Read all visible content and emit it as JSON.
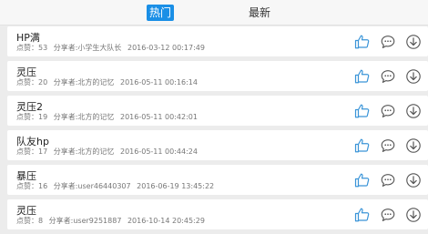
{
  "tabs": {
    "hot": "热门",
    "latest": "最新"
  },
  "colors": {
    "accent": "#1a8fe6",
    "like_icon": "#3b95d8",
    "icon_dark": "#555555"
  },
  "items": [
    {
      "title": "HP满",
      "likes_label": "点赞：53",
      "sharer_label": "分享者:小学生大队长",
      "timestamp": "2016-03-12 00:17:49"
    },
    {
      "title": "灵压",
      "likes_label": "点赞：20",
      "sharer_label": "分享者:北方的记忆",
      "timestamp": "2016-05-11 00:16:14"
    },
    {
      "title": "灵压2",
      "likes_label": "点赞：19",
      "sharer_label": "分享者:北方的记忆",
      "timestamp": "2016-05-11 00:42:01"
    },
    {
      "title": "队友hp",
      "likes_label": "点赞：17",
      "sharer_label": "分享者:北方的记忆",
      "timestamp": "2016-05-11 00:44:24"
    },
    {
      "title": "暴压",
      "likes_label": "点赞：16",
      "sharer_label": "分享者:user46440307",
      "timestamp": "2016-06-19 13:45:22"
    },
    {
      "title": "灵压",
      "likes_label": "点赞：8",
      "sharer_label": "分享者:user9251887",
      "timestamp": "2016-10-14 20:45:29"
    }
  ]
}
